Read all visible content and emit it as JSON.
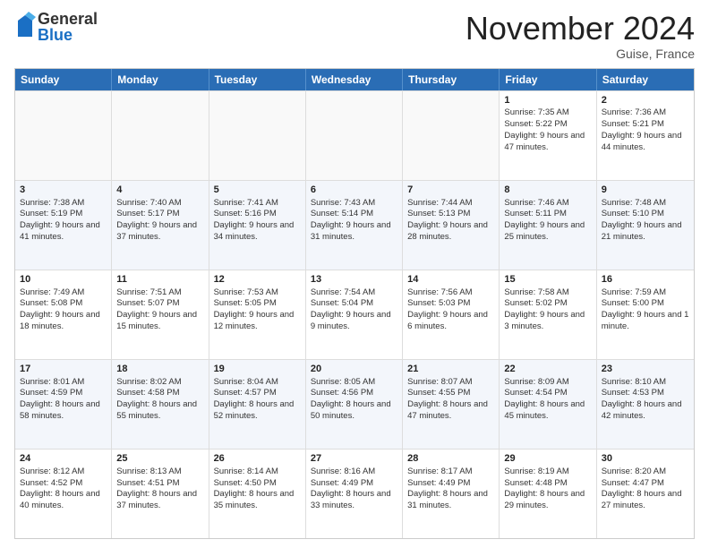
{
  "logo": {
    "general": "General",
    "blue": "Blue"
  },
  "title": "November 2024",
  "subtitle": "Guise, France",
  "days": [
    "Sunday",
    "Monday",
    "Tuesday",
    "Wednesday",
    "Thursday",
    "Friday",
    "Saturday"
  ],
  "rows": [
    [
      {
        "day": "",
        "content": "",
        "empty": true
      },
      {
        "day": "",
        "content": "",
        "empty": true
      },
      {
        "day": "",
        "content": "",
        "empty": true
      },
      {
        "day": "",
        "content": "",
        "empty": true
      },
      {
        "day": "",
        "content": "",
        "empty": true
      },
      {
        "day": "1",
        "content": "Sunrise: 7:35 AM\nSunset: 5:22 PM\nDaylight: 9 hours and 47 minutes.",
        "empty": false
      },
      {
        "day": "2",
        "content": "Sunrise: 7:36 AM\nSunset: 5:21 PM\nDaylight: 9 hours and 44 minutes.",
        "empty": false
      }
    ],
    [
      {
        "day": "3",
        "content": "Sunrise: 7:38 AM\nSunset: 5:19 PM\nDaylight: 9 hours and 41 minutes.",
        "empty": false
      },
      {
        "day": "4",
        "content": "Sunrise: 7:40 AM\nSunset: 5:17 PM\nDaylight: 9 hours and 37 minutes.",
        "empty": false
      },
      {
        "day": "5",
        "content": "Sunrise: 7:41 AM\nSunset: 5:16 PM\nDaylight: 9 hours and 34 minutes.",
        "empty": false
      },
      {
        "day": "6",
        "content": "Sunrise: 7:43 AM\nSunset: 5:14 PM\nDaylight: 9 hours and 31 minutes.",
        "empty": false
      },
      {
        "day": "7",
        "content": "Sunrise: 7:44 AM\nSunset: 5:13 PM\nDaylight: 9 hours and 28 minutes.",
        "empty": false
      },
      {
        "day": "8",
        "content": "Sunrise: 7:46 AM\nSunset: 5:11 PM\nDaylight: 9 hours and 25 minutes.",
        "empty": false
      },
      {
        "day": "9",
        "content": "Sunrise: 7:48 AM\nSunset: 5:10 PM\nDaylight: 9 hours and 21 minutes.",
        "empty": false
      }
    ],
    [
      {
        "day": "10",
        "content": "Sunrise: 7:49 AM\nSunset: 5:08 PM\nDaylight: 9 hours and 18 minutes.",
        "empty": false
      },
      {
        "day": "11",
        "content": "Sunrise: 7:51 AM\nSunset: 5:07 PM\nDaylight: 9 hours and 15 minutes.",
        "empty": false
      },
      {
        "day": "12",
        "content": "Sunrise: 7:53 AM\nSunset: 5:05 PM\nDaylight: 9 hours and 12 minutes.",
        "empty": false
      },
      {
        "day": "13",
        "content": "Sunrise: 7:54 AM\nSunset: 5:04 PM\nDaylight: 9 hours and 9 minutes.",
        "empty": false
      },
      {
        "day": "14",
        "content": "Sunrise: 7:56 AM\nSunset: 5:03 PM\nDaylight: 9 hours and 6 minutes.",
        "empty": false
      },
      {
        "day": "15",
        "content": "Sunrise: 7:58 AM\nSunset: 5:02 PM\nDaylight: 9 hours and 3 minutes.",
        "empty": false
      },
      {
        "day": "16",
        "content": "Sunrise: 7:59 AM\nSunset: 5:00 PM\nDaylight: 9 hours and 1 minute.",
        "empty": false
      }
    ],
    [
      {
        "day": "17",
        "content": "Sunrise: 8:01 AM\nSunset: 4:59 PM\nDaylight: 8 hours and 58 minutes.",
        "empty": false
      },
      {
        "day": "18",
        "content": "Sunrise: 8:02 AM\nSunset: 4:58 PM\nDaylight: 8 hours and 55 minutes.",
        "empty": false
      },
      {
        "day": "19",
        "content": "Sunrise: 8:04 AM\nSunset: 4:57 PM\nDaylight: 8 hours and 52 minutes.",
        "empty": false
      },
      {
        "day": "20",
        "content": "Sunrise: 8:05 AM\nSunset: 4:56 PM\nDaylight: 8 hours and 50 minutes.",
        "empty": false
      },
      {
        "day": "21",
        "content": "Sunrise: 8:07 AM\nSunset: 4:55 PM\nDaylight: 8 hours and 47 minutes.",
        "empty": false
      },
      {
        "day": "22",
        "content": "Sunrise: 8:09 AM\nSunset: 4:54 PM\nDaylight: 8 hours and 45 minutes.",
        "empty": false
      },
      {
        "day": "23",
        "content": "Sunrise: 8:10 AM\nSunset: 4:53 PM\nDaylight: 8 hours and 42 minutes.",
        "empty": false
      }
    ],
    [
      {
        "day": "24",
        "content": "Sunrise: 8:12 AM\nSunset: 4:52 PM\nDaylight: 8 hours and 40 minutes.",
        "empty": false
      },
      {
        "day": "25",
        "content": "Sunrise: 8:13 AM\nSunset: 4:51 PM\nDaylight: 8 hours and 37 minutes.",
        "empty": false
      },
      {
        "day": "26",
        "content": "Sunrise: 8:14 AM\nSunset: 4:50 PM\nDaylight: 8 hours and 35 minutes.",
        "empty": false
      },
      {
        "day": "27",
        "content": "Sunrise: 8:16 AM\nSunset: 4:49 PM\nDaylight: 8 hours and 33 minutes.",
        "empty": false
      },
      {
        "day": "28",
        "content": "Sunrise: 8:17 AM\nSunset: 4:49 PM\nDaylight: 8 hours and 31 minutes.",
        "empty": false
      },
      {
        "day": "29",
        "content": "Sunrise: 8:19 AM\nSunset: 4:48 PM\nDaylight: 8 hours and 29 minutes.",
        "empty": false
      },
      {
        "day": "30",
        "content": "Sunrise: 8:20 AM\nSunset: 4:47 PM\nDaylight: 8 hours and 27 minutes.",
        "empty": false
      }
    ]
  ]
}
